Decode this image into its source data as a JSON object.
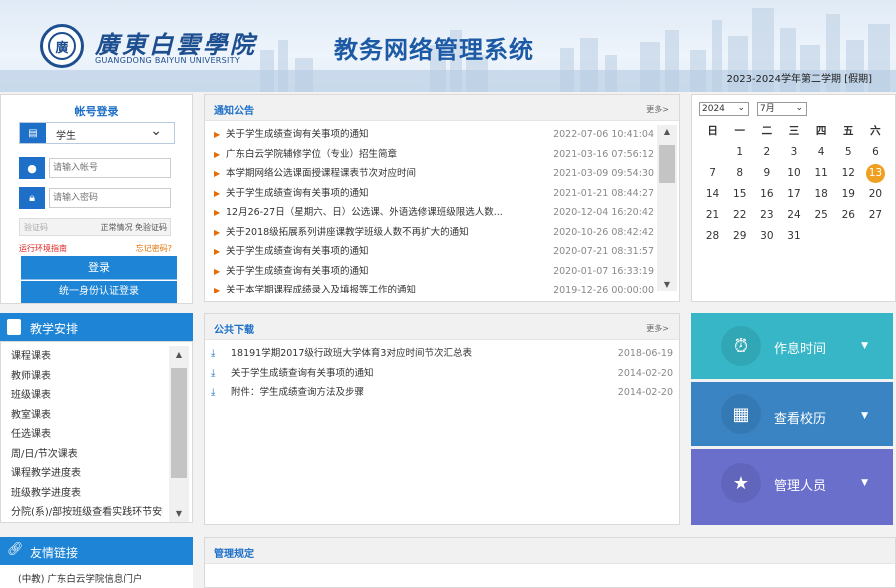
{
  "header": {
    "logo_text": "廣",
    "school_name_cn": "廣東白雲學院",
    "school_name_en": "GUANGDONG BAIYUN UNIVERSITY",
    "system_title": "教务网络管理系统",
    "term": "2023-2024学年第二学期 [假期]"
  },
  "login": {
    "title": "帐号登录",
    "role_selected": "学生",
    "account_placeholder": "请输入帐号",
    "password_placeholder": "请输入密码",
    "captcha_placeholder": "验证码",
    "captcha_note": "正常情况 免验证码",
    "env_guide": "运行环境指南",
    "forgot": "忘记密码?",
    "login_button": "登录",
    "unified_button": "统一身份认证登录"
  },
  "notice": {
    "title": "通知公告",
    "more": "更多>",
    "items": [
      {
        "title": "关于学生成绩查询有关事项的通知",
        "date": "2022-07-06 10:41:04"
      },
      {
        "title": "广东白云学院辅修学位（专业）招生简章",
        "date": "2021-03-16 07:56:12"
      },
      {
        "title": "本学期网络公选课面授课程课表节次对应时间",
        "date": "2021-03-09 09:54:30"
      },
      {
        "title": "关于学生成绩查询有关事项的通知",
        "date": "2021-01-21 08:44:27"
      },
      {
        "title": "12月26-27日（星期六、日）公选课、外语选修课班级限选人数...",
        "date": "2020-12-04 16:20:42"
      },
      {
        "title": "关于2018级拓展系列讲座课教学班级人数不再扩大的通知",
        "date": "2020-10-26 08:42:42"
      },
      {
        "title": "关于学生成绩查询有关事项的通知",
        "date": "2020-07-21 08:31:57"
      },
      {
        "title": "关于学生成绩查询有关事项的通知",
        "date": "2020-01-07 16:33:19"
      },
      {
        "title": "关于本学期课程成绩录入及填报等工作的通知",
        "date": "2019-12-26 00:00:00"
      }
    ]
  },
  "calendar": {
    "year": "2024",
    "month": "7月",
    "weekdays": [
      "日",
      "一",
      "二",
      "三",
      "四",
      "五",
      "六"
    ],
    "weeks": [
      [
        "",
        "1",
        "2",
        "3",
        "4",
        "5",
        "6"
      ],
      [
        "7",
        "8",
        "9",
        "10",
        "11",
        "12",
        "13"
      ],
      [
        "14",
        "15",
        "16",
        "17",
        "18",
        "19",
        "20"
      ],
      [
        "21",
        "22",
        "23",
        "24",
        "25",
        "26",
        "27"
      ],
      [
        "28",
        "29",
        "30",
        "31",
        "",
        "",
        ""
      ]
    ],
    "today": "13"
  },
  "teaching": {
    "title": "教学安排",
    "items": [
      "课程课表",
      "教师课表",
      "班级课表",
      "教室课表",
      "任选课表",
      "周/日/节次课表",
      "课程教学进度表",
      "班级教学进度表",
      "分院(系)/部按班级查看实践环节安排"
    ]
  },
  "downloads": {
    "title": "公共下载",
    "more": "更多>",
    "items": [
      {
        "title": "18191学期2017级行政班大学体育3对应时间节次汇总表",
        "date": "2018-06-19"
      },
      {
        "title": "关于学生成绩查询有关事项的通知",
        "date": "2014-02-20"
      },
      {
        "title": "附件：学生成绩查询方法及步骤",
        "date": "2014-02-20"
      }
    ]
  },
  "tiles": [
    {
      "label": "作息时间",
      "icon": "alarm-clock-icon",
      "color": "#36b6c6"
    },
    {
      "label": "查看校历",
      "icon": "calendar-icon",
      "color": "#3a84c4"
    },
    {
      "label": "管理人员",
      "icon": "user-star-icon",
      "color": "#6a6fcc"
    }
  ],
  "links": {
    "title": "友情链接",
    "first": "(中教) 广东白云学院信息门户"
  },
  "management": {
    "title": "管理规定"
  }
}
